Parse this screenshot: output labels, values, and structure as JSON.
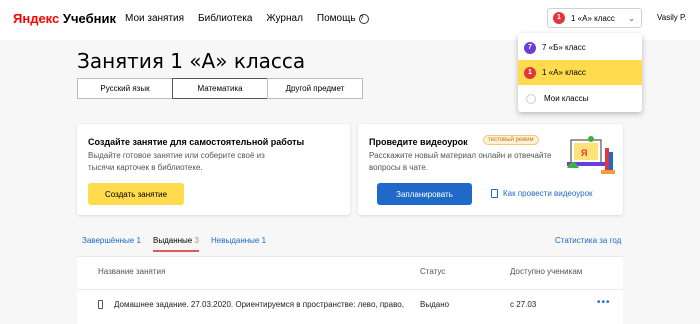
{
  "header": {
    "logo_brand": "Яндекс",
    "logo_product": "Учебник",
    "nav": [
      "Мои занятия",
      "Библиотека",
      "Журнал",
      "Помощь"
    ],
    "class_select": {
      "badge": "1",
      "label": "1 «А» класс"
    },
    "user": "Vasily P."
  },
  "dropdown": {
    "items": [
      {
        "badge": "7",
        "label": "7 «Б» класс",
        "color": "#6a3ed8"
      },
      {
        "badge": "1",
        "label": "1 «А» класс",
        "color": "#e0363c",
        "selected": true
      },
      {
        "label": "Мои классы"
      }
    ]
  },
  "page": {
    "title": "Занятия 1 «А» класса",
    "subjects": [
      "Русский язык",
      "Математика",
      "Другой предмет"
    ],
    "active_subject": "Математика"
  },
  "card_create": {
    "title": "Создайте занятие для самостоятельной работы",
    "text_line1": "Выдайте готовое занятие или соберите своё из",
    "text_line2": "тысячи карточек в библиотеке.",
    "button": "Создать занятие"
  },
  "card_video": {
    "title": "Проведите видеоурок",
    "badge": "тестовый режим",
    "text_line1": "Расскажите новый материал онлайн и отвечайте",
    "text_line2": "вопросы в чате.",
    "button": "Запланировать",
    "link": "Как провести видеоурок"
  },
  "lesson_tabs": [
    {
      "label": "Завершённые",
      "count": "1"
    },
    {
      "label": "Выданные",
      "count": "3"
    },
    {
      "label": "Невыданные",
      "count": "1"
    }
  ],
  "stats_link": "Статистика за год",
  "table": {
    "headers": [
      "Название занятия",
      "Статус",
      "Доступно ученикам"
    ],
    "rows": [
      {
        "name": "Домашнее задание. 27.03.2020. Ориентируемся в пространстве: лево, право,",
        "status": "Выдано",
        "available": "с 27.03"
      }
    ]
  },
  "colors": {
    "accent_yellow": "#ffdb4d",
    "primary_blue": "#1f6ac9",
    "brand_red": "#ff0000"
  }
}
